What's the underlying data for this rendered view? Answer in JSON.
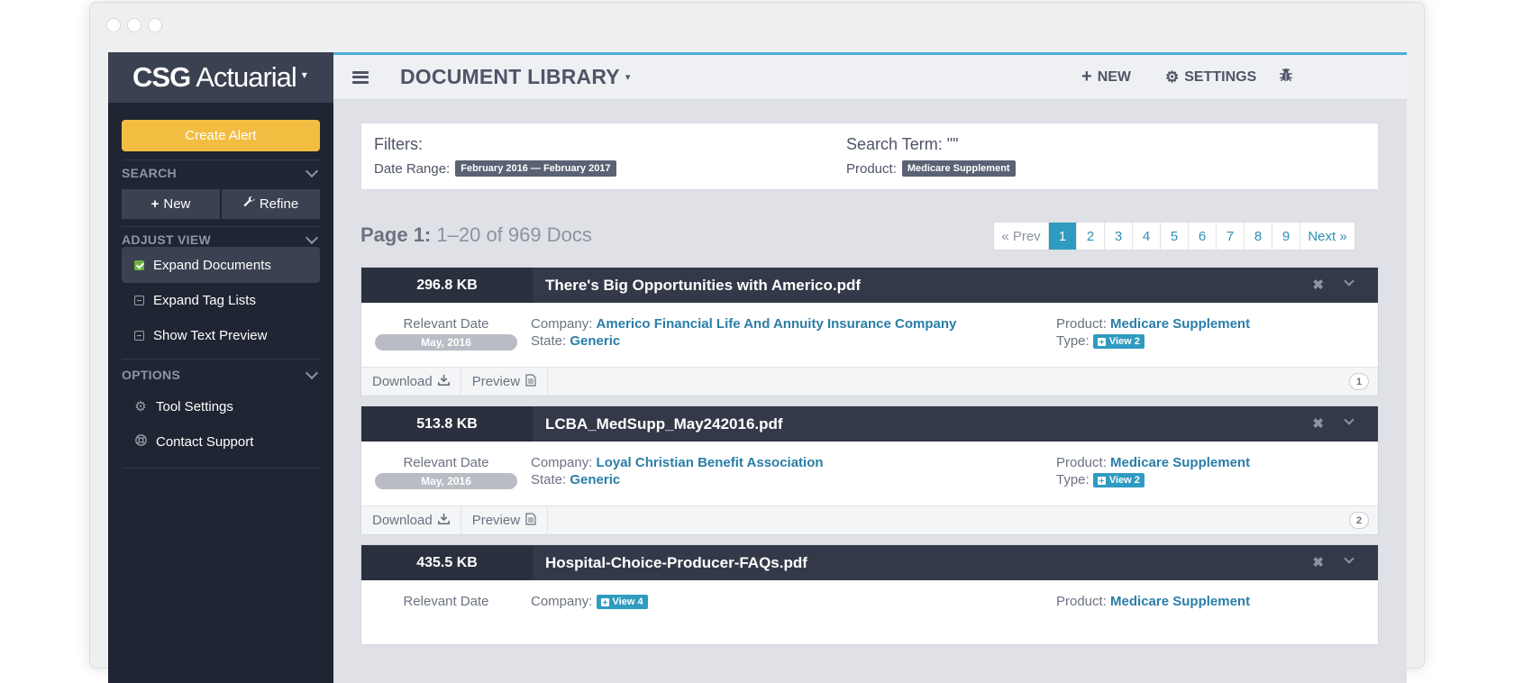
{
  "brand": {
    "part1": "CSG",
    "part2": "Actuarial",
    "caret": "▾"
  },
  "sidebar": {
    "create_alert": "Create Alert",
    "search_heading": "SEARCH",
    "new_label": "New",
    "refine_label": "Refine",
    "adjust_heading": "ADJUST VIEW",
    "view_options": [
      {
        "label": "Expand Documents",
        "checked": true
      },
      {
        "label": "Expand Tag Lists",
        "checked": false
      },
      {
        "label": "Show Text Preview",
        "checked": false
      }
    ],
    "options_heading": "OPTIONS",
    "tool_settings": "Tool Settings",
    "contact_support": "Contact Support"
  },
  "header": {
    "title": "DOCUMENT LIBRARY",
    "new_label": "NEW",
    "settings_label": "SETTINGS"
  },
  "filters": {
    "title": "Filters:",
    "date_range_label": "Date Range:",
    "date_range_value": "February 2016 — February 2017",
    "search_term_label": "Search Term: \"\"",
    "product_label": "Product:",
    "product_value": "Medicare Supplement"
  },
  "pagination": {
    "page_label": "Page 1:",
    "range_text": "1–20 of 969 Docs",
    "prev": "« Prev",
    "pages": [
      "1",
      "2",
      "3",
      "4",
      "5",
      "6",
      "7",
      "8",
      "9"
    ],
    "current": "1",
    "next": "Next »"
  },
  "docs": [
    {
      "size": "296.8 KB",
      "name": "There's Big Opportunities with Americo.pdf",
      "date_label": "Relevant Date",
      "date": "May, 2016",
      "company_label": "Company:",
      "company": "Americo Financial Life And Annuity Insurance Company",
      "state_label": "State:",
      "state": "Generic",
      "product_label": "Product:",
      "product": "Medicare Supplement",
      "type_label": "Type:",
      "type_tag": "View 2",
      "download": "Download",
      "preview": "Preview",
      "index": "1"
    },
    {
      "size": "513.8 KB",
      "name": "LCBA_MedSupp_May242016.pdf",
      "date_label": "Relevant Date",
      "date": "May, 2016",
      "company_label": "Company:",
      "company": "Loyal Christian Benefit Association",
      "state_label": "State:",
      "state": "Generic",
      "product_label": "Product:",
      "product": "Medicare Supplement",
      "type_label": "Type:",
      "type_tag": "View 2",
      "download": "Download",
      "preview": "Preview",
      "index": "2"
    },
    {
      "size": "435.5 KB",
      "name": "Hospital-Choice-Producer-FAQs.pdf",
      "date_label": "Relevant Date",
      "company_label": "Company:",
      "company_tag": "View 4",
      "product_label": "Product:",
      "product": "Medicare Supplement"
    }
  ]
}
